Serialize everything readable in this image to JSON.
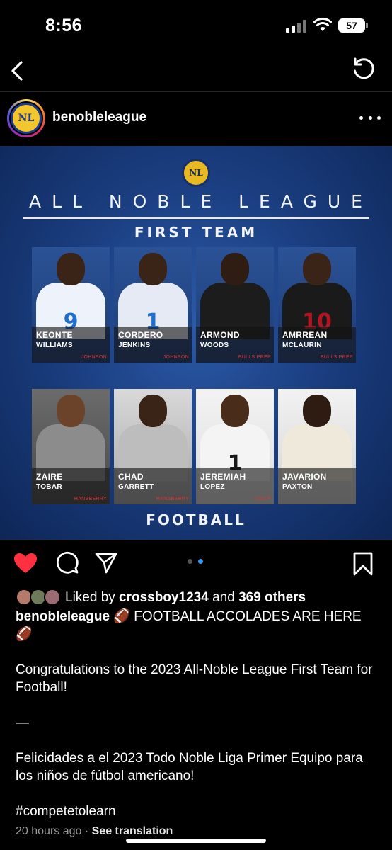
{
  "status_bar": {
    "time": "8:56",
    "battery": "57"
  },
  "post": {
    "username": "benobleleague",
    "avatar_text": "NL",
    "image": {
      "logo_text": "NL",
      "title": "ALL NOBLE LEAGUE",
      "subtitle": "FIRST TEAM",
      "footer": "FOOTBALL",
      "players": [
        {
          "first": "KEONTE",
          "last": "WILLIAMS",
          "school": "JOHNSON",
          "jersey": "9"
        },
        {
          "first": "CORDERO",
          "last": "JENKINS",
          "school": "JOHNSON",
          "jersey": "1"
        },
        {
          "first": "ARMOND",
          "last": "WOODS",
          "school": "BULLS PREP",
          "jersey": ""
        },
        {
          "first": "AMRREAN",
          "last": "MCLAURIN",
          "school": "BULLS PREP",
          "jersey": "10"
        },
        {
          "first": "ZAIRE",
          "last": "TOBAR",
          "school": "HANSBERRY",
          "jersey": ""
        },
        {
          "first": "CHAD",
          "last": "GARRETT",
          "school": "HANSBERRY",
          "jersey": ""
        },
        {
          "first": "JEREMIAH",
          "last": "LOPEZ",
          "school": "UICCP",
          "jersey": "1"
        },
        {
          "first": "JAVARION",
          "last": "PAXTON",
          "school": "",
          "jersey": ""
        }
      ]
    },
    "carousel": {
      "total": 2,
      "active_index": 1
    },
    "liked": true,
    "likes": {
      "prefix": "Liked by ",
      "user": "crossboy1234",
      "middle": " and ",
      "others": "369 others"
    },
    "caption": {
      "line1": "🏈 FOOTBALL ACCOLADES ARE HERE 🏈",
      "para1": "Congratulations to the 2023 All-Noble League First Team for Football!",
      "divider": "—",
      "para2": "Felicidades a el 2023 Todo Noble Liga Primer Equipo para los niños de fútbol americano!",
      "hashtag": "#competetolearn"
    },
    "timestamp": "20 hours ago",
    "separator": " · ",
    "see_translation": "See translation"
  },
  "colors": {
    "heart": "#ff3040",
    "carousel_active": "#3797f0",
    "carousel_inactive": "#555555"
  }
}
